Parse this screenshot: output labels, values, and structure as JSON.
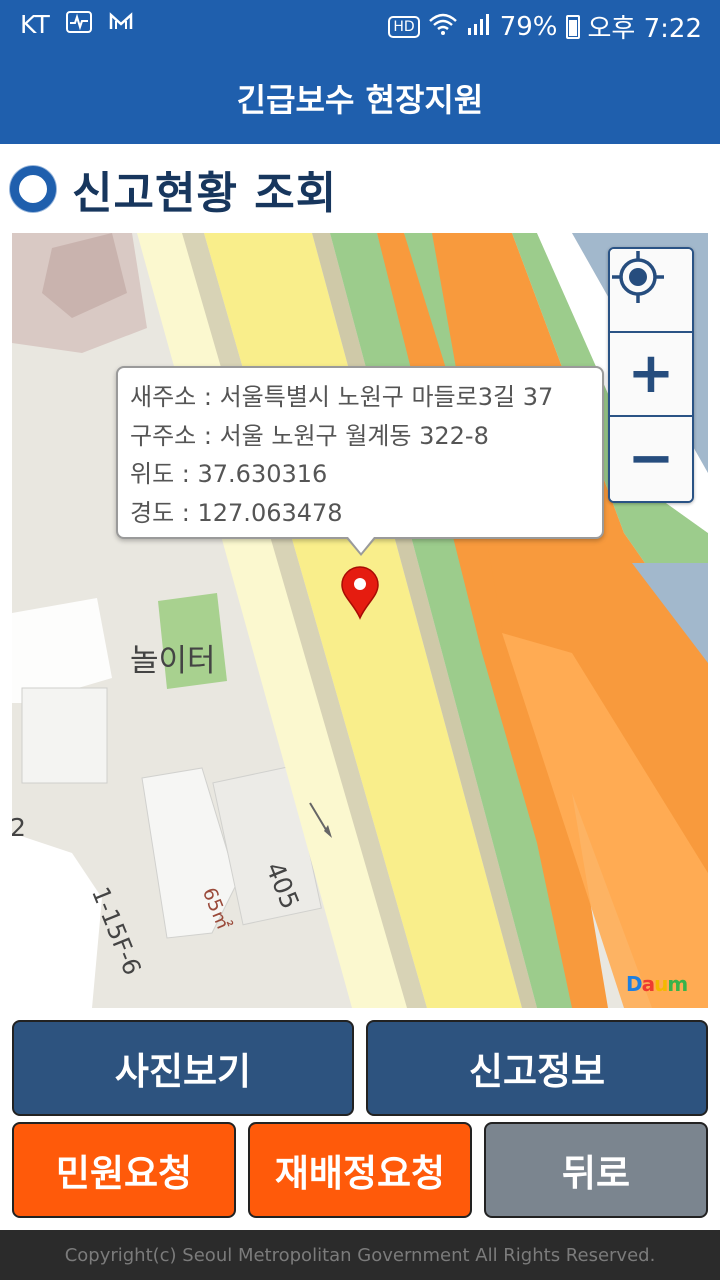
{
  "status_bar": {
    "carrier": "KT",
    "icons": [
      "activity-icon",
      "mail-m-icon",
      "hd-icon",
      "wifi-icon",
      "signal-icon",
      "battery-icon"
    ],
    "hd_label": "HD",
    "battery": "79%",
    "time": "오후 7:22"
  },
  "app_bar": {
    "title": "긴급보수 현장지원"
  },
  "page": {
    "title": "신고현황 조회"
  },
  "map": {
    "popup": {
      "new_address": "새주소 : 서울특별시 노원구 마들로3길 37",
      "old_address": "구주소 : 서울 노원구 월계동 322-8",
      "latitude": "위도 : 37.630316",
      "longitude": "경도 : 127.063478"
    },
    "labels": {
      "playground": "놀이터",
      "lot": "1-15F-6",
      "area": "65㎡",
      "road_number": "405",
      "edge_number": "2"
    },
    "controls": {
      "zoom_in": "+",
      "zoom_out": "−"
    },
    "logo": [
      "D",
      "a",
      "u",
      "m"
    ]
  },
  "buttons": {
    "photo": "사진보기",
    "report_info": "신고정보",
    "civil_request": "민원요청",
    "reassign_request": "재배정요청",
    "back": "뒤로"
  },
  "footer": "Copyright(c) Seoul Metropolitan Government All Rights Reserved.",
  "colors": {
    "primary_blue": "#1f5fad",
    "button_blue": "#2d537f",
    "button_orange": "#ff5a0a",
    "button_gray": "#7b858f",
    "road_yellow": "#f9ee8b",
    "road_orange": "#f89a3d",
    "green": "#9ccc8c"
  }
}
